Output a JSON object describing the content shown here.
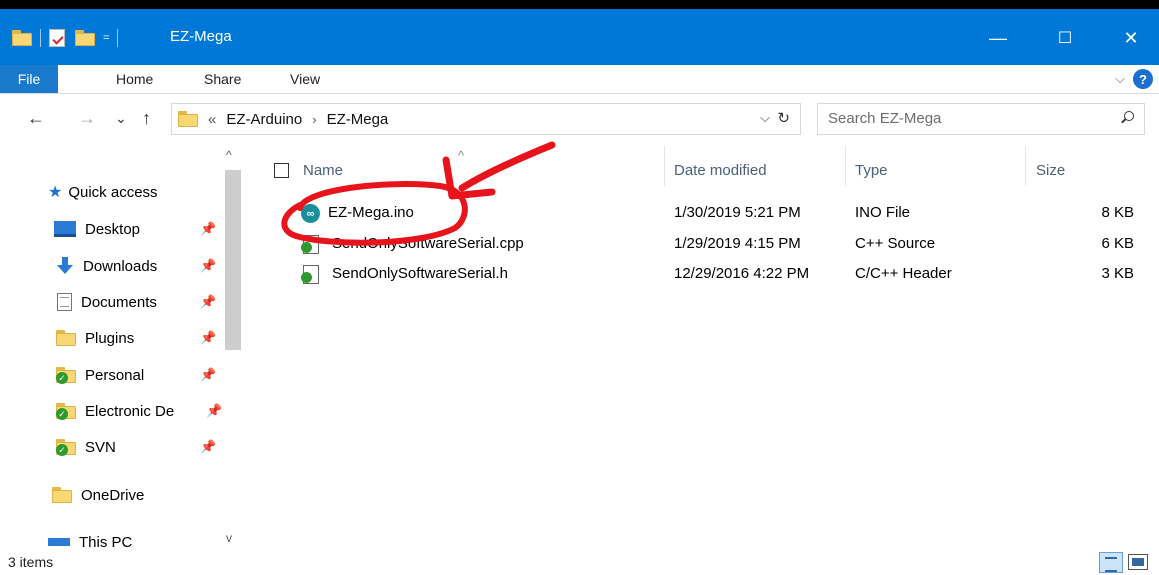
{
  "window": {
    "title": "EZ-Mega",
    "quick_access_dropdown": "=",
    "minimize": "—",
    "maximize": "☐",
    "close": "✕"
  },
  "ribbon": {
    "file": "File",
    "tabs": [
      "Home",
      "Share",
      "View"
    ],
    "expand": "⌵",
    "help": "?"
  },
  "navigation": {
    "back": "←",
    "forward": "→",
    "recent": "⌄",
    "up": "↑",
    "address_prefix": "«",
    "breadcrumb": [
      "EZ-Arduino",
      "EZ-Mega"
    ],
    "breadcrumb_separator": "›",
    "address_dropdown": "⌵",
    "refresh": "↻",
    "search_placeholder": "Search EZ-Mega"
  },
  "sidebar": {
    "quick_access": "Quick access",
    "pin_glyph": "📌",
    "items": [
      {
        "label": "Desktop",
        "icon": "desktop-icon",
        "pinned": true
      },
      {
        "label": "Downloads",
        "icon": "download-icon",
        "pinned": true
      },
      {
        "label": "Documents",
        "icon": "documents-icon",
        "pinned": true
      },
      {
        "label": "Plugins",
        "icon": "folder-icon",
        "pinned": true
      },
      {
        "label": "Personal",
        "icon": "svn-folder-icon",
        "pinned": true
      },
      {
        "label": "Electronic De",
        "icon": "svn-folder-icon",
        "pinned": true
      },
      {
        "label": "SVN",
        "icon": "svn-folder-icon",
        "pinned": true
      }
    ],
    "onedrive": "OneDrive",
    "this_pc": "This PC"
  },
  "file_list": {
    "columns": {
      "name": "Name",
      "date_modified": "Date modified",
      "type": "Type",
      "size": "Size"
    },
    "rows": [
      {
        "name": "EZ-Mega.ino",
        "date": "1/30/2019 5:21 PM",
        "type": "INO File",
        "size": "8 KB",
        "icon": "arduino-ino-icon"
      },
      {
        "name": "SendOnlySoftwareSerial.cpp",
        "date": "1/29/2019 4:15 PM",
        "type": "C++ Source",
        "size": "6 KB",
        "icon": "cpp-file-icon"
      },
      {
        "name": "SendOnlySoftwareSerial.h",
        "date": "12/29/2016 4:22 PM",
        "type": "C/C++ Header",
        "size": "3 KB",
        "icon": "header-file-icon"
      }
    ]
  },
  "status": {
    "item_count": "3 items"
  },
  "colors": {
    "titlebar": "#0078d7",
    "file_tab": "#1979ca",
    "annotation": "#e8141b"
  }
}
